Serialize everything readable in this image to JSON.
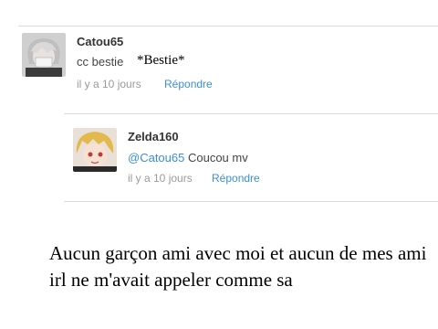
{
  "comments": [
    {
      "username": "Catou65",
      "text": "cc bestie",
      "time": "il y a 10 jours",
      "reply_label": "Répondre"
    },
    {
      "username": "Zelda160",
      "mention": "@Catou65",
      "text": " Coucou mv",
      "time": "il y a 10 jours",
      "reply_label": "Répondre"
    }
  ],
  "overlay_note": "*Bestie*",
  "caption": "Aucun garçon ami avec moi et aucun de mes ami irl ne m'avait appeler comme sa",
  "colors": {
    "accent": "#3a8fd9",
    "meta": "#9a9a9a",
    "divider": "#dcdcdc"
  }
}
